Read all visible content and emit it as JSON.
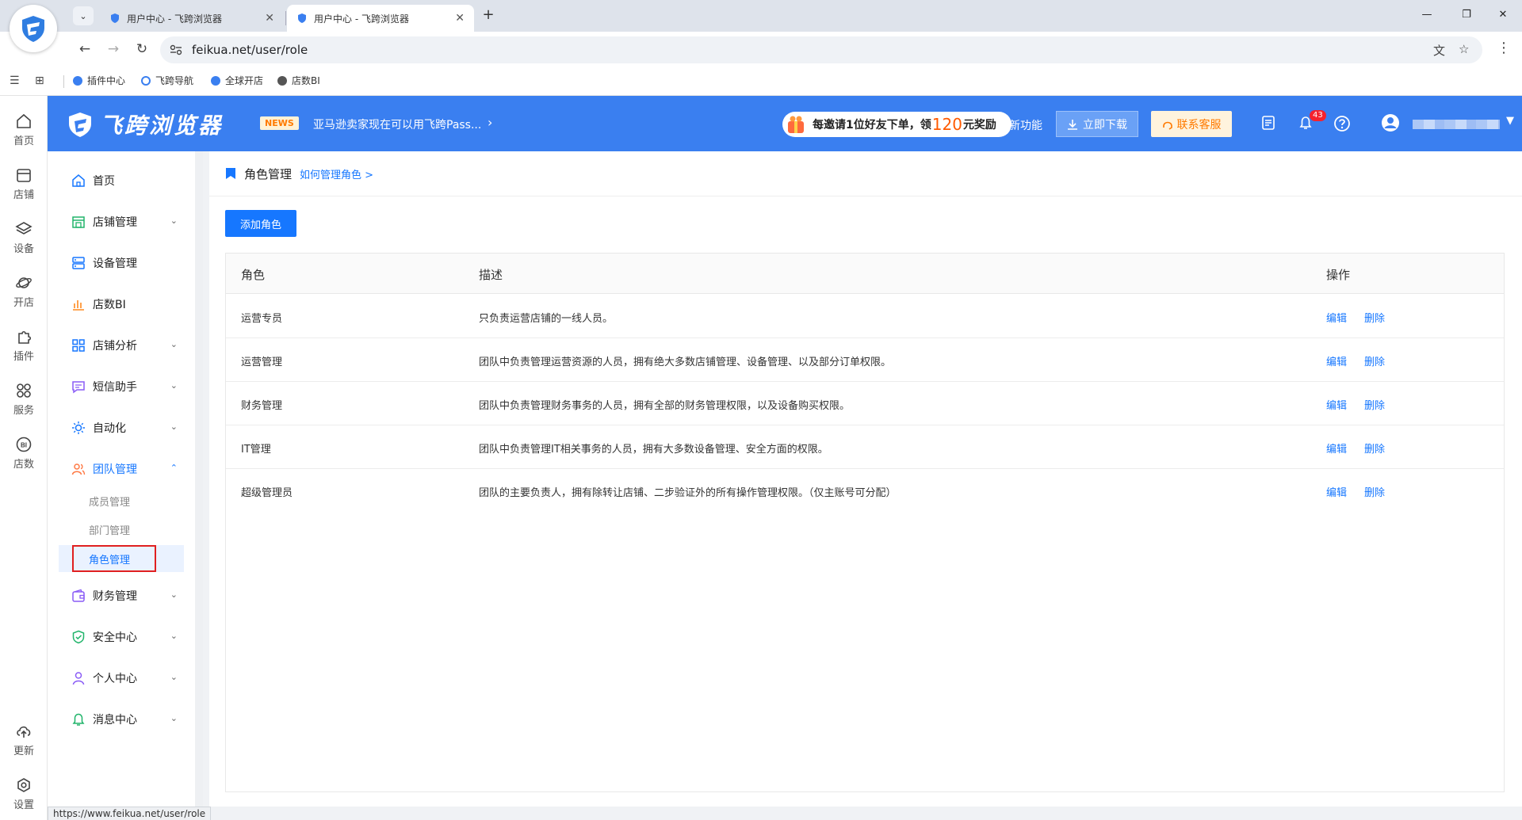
{
  "browser": {
    "tabs": [
      {
        "title": "用户中心 - 飞跨浏览器",
        "active": false
      },
      {
        "title": "用户中心 - 飞跨浏览器",
        "active": true
      }
    ],
    "url": "feikua.net/user/role",
    "bookmarks": [
      "插件中心",
      "飞跨导航",
      "全球开店",
      "店数BI"
    ],
    "status_url": "https://www.feikua.net/user/role"
  },
  "rail": {
    "top": [
      "首页",
      "店铺",
      "设备",
      "开店",
      "插件",
      "服务",
      "店数"
    ],
    "bottom": [
      "更新",
      "设置"
    ]
  },
  "header": {
    "logo_text": "飞跨浏览器",
    "news_badge": "NEWS",
    "news_text": "亚马逊卖家现在可以用飞跨Pass...",
    "promo_prefix": "每邀请1位好友下单，领",
    "promo_amount": "120",
    "promo_suffix": "元奖励",
    "new_features": "新功能",
    "download": "立即下载",
    "contact": "联系客服",
    "notification_count": "43"
  },
  "sidebar": {
    "items": [
      {
        "label": "首页",
        "icon": "home-icon"
      },
      {
        "label": "店铺管理",
        "icon": "store-icon"
      },
      {
        "label": "设备管理",
        "icon": "server-icon"
      },
      {
        "label": "店数BI",
        "icon": "bar-chart-icon"
      },
      {
        "label": "店铺分析",
        "icon": "grid-icon"
      },
      {
        "label": "短信助手",
        "icon": "message-icon"
      },
      {
        "label": "自动化",
        "icon": "sun-icon"
      },
      {
        "label": "团队管理",
        "icon": "team-icon"
      },
      {
        "label": "财务管理",
        "icon": "wallet-icon"
      },
      {
        "label": "安全中心",
        "icon": "shield-icon"
      },
      {
        "label": "个人中心",
        "icon": "user-icon"
      },
      {
        "label": "消息中心",
        "icon": "bell-icon"
      }
    ],
    "team_sub": [
      "成员管理",
      "部门管理",
      "角色管理"
    ]
  },
  "page": {
    "title": "角色管理",
    "help_link": "如何管理角色 >",
    "add_button": "添加角色",
    "columns": [
      "角色",
      "描述",
      "操作"
    ],
    "rows": [
      {
        "role": "运营专员",
        "desc": "只负责运营店铺的一线人员。"
      },
      {
        "role": "运营管理",
        "desc": "团队中负责管理运营资源的人员，拥有绝大多数店铺管理、设备管理、以及部分订单权限。"
      },
      {
        "role": "财务管理",
        "desc": "团队中负责管理财务事务的人员，拥有全部的财务管理权限，以及设备购买权限。"
      },
      {
        "role": "IT管理",
        "desc": "团队中负责管理IT相关事务的人员，拥有大多数设备管理、安全方面的权限。"
      },
      {
        "role": "超级管理员",
        "desc": "团队的主要负责人，拥有除转让店铺、二步验证外的所有操作管理权限。（仅主账号可分配）"
      }
    ],
    "edit_label": "编辑",
    "delete_label": "删除"
  },
  "colors": {
    "brand": "#3a7ff0",
    "link": "#1677ff",
    "highlight_box": "#e02020"
  }
}
